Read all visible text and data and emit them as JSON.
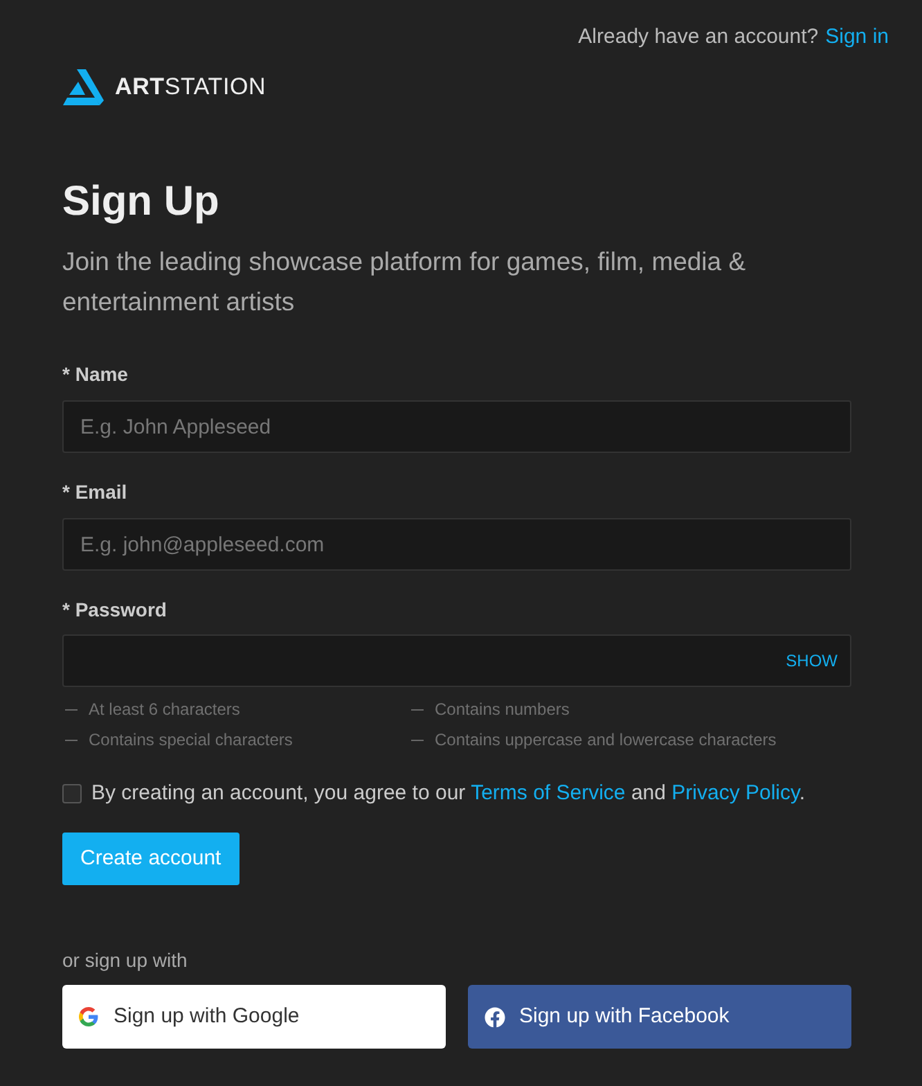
{
  "header": {
    "prompt": "Already have an account?",
    "link": "Sign in"
  },
  "logo": {
    "wordmark": "**ART**STATION"
  },
  "title": "Sign Up",
  "subtitle": "Join the leading showcase platform for games, film, media & entertainment artists",
  "fields": [
    {
      "kind": "text",
      "label": "* Name",
      "placeholder": "E.g. John Appleseed"
    },
    {
      "kind": "text",
      "label": "* Email",
      "placeholder": "E.g. john@appleseed.com"
    },
    {
      "kind": "password",
      "label": "* Password",
      "toggle": "SHOW"
    }
  ],
  "requirements": [
    "At least 6 characters",
    "Contains numbers",
    "Contains special characters",
    "Contains uppercase and lowercase characters"
  ],
  "agreement": {
    "checked": false,
    "segments": [
      {
        "kind": "text",
        "text": "By creating an account, you agree to our "
      },
      {
        "kind": "link",
        "text": "Terms of Service"
      },
      {
        "kind": "text",
        "text": " and "
      },
      {
        "kind": "link",
        "text": "Privacy Policy"
      },
      {
        "kind": "text",
        "text": "."
      }
    ]
  },
  "submit": "Create account",
  "social": {
    "heading": "or sign up with",
    "buttons": [
      {
        "kind": "google",
        "label": "Sign up with Google"
      },
      {
        "kind": "facebook",
        "label": "Sign up with Facebook"
      }
    ]
  }
}
